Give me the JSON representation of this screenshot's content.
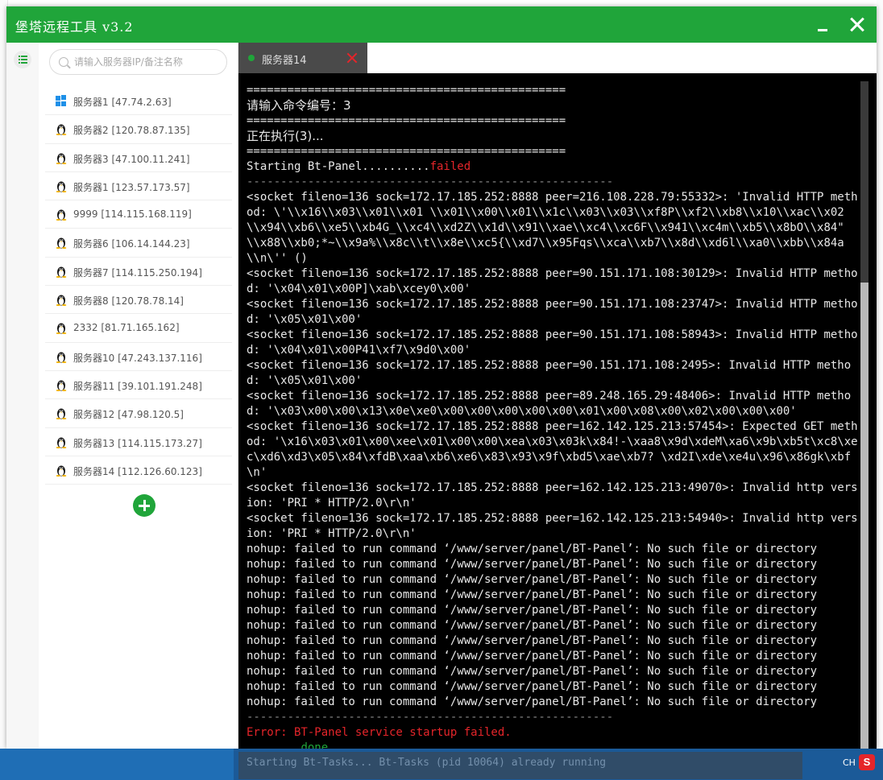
{
  "window": {
    "title": "堡塔远程工具 v3.2"
  },
  "sidebar": {
    "search_placeholder": "请输入服务器IP/备注名称",
    "servers": [
      {
        "label": "服务器1 [47.74.2.63]",
        "os": "windows-icon"
      },
      {
        "label": "服务器2 [120.78.87.135]",
        "os": "linux-icon"
      },
      {
        "label": "服务器3 [47.100.11.241]",
        "os": "linux-icon"
      },
      {
        "label": "服务器1 [123.57.173.57]",
        "os": "linux-icon"
      },
      {
        "label": "9999 [114.115.168.119]",
        "os": "linux-icon"
      },
      {
        "label": "服务器6 [106.14.144.23]",
        "os": "linux-icon"
      },
      {
        "label": "服务器7 [114.115.250.194]",
        "os": "linux-icon"
      },
      {
        "label": "服务器8 [120.78.78.14]",
        "os": "linux-icon"
      },
      {
        "label": "2332 [81.71.165.162]",
        "os": "linux-icon"
      },
      {
        "label": "服务器10 [47.243.137.116]",
        "os": "linux-icon"
      },
      {
        "label": "服务器11 [39.101.191.248]",
        "os": "linux-icon"
      },
      {
        "label": "服务器12 [47.98.120.5]",
        "os": "linux-icon"
      },
      {
        "label": "服务器13 [114.115.173.27]",
        "os": "linux-icon"
      },
      {
        "label": "服务器14 [112.126.60.123]",
        "os": "linux-icon"
      }
    ]
  },
  "tabs": [
    {
      "label": "服务器14",
      "status_color": "#20a53a"
    }
  ],
  "terminal": {
    "lines": [
      {
        "text": "===============================================",
        "cls": ""
      },
      {
        "text": "请输入命令编号：3",
        "cls": "big"
      },
      {
        "text": "===============================================",
        "cls": ""
      },
      {
        "text": "正在执行(3)...",
        "cls": "big"
      },
      {
        "text": "===============================================",
        "cls": ""
      },
      {
        "text": "Starting Bt-Panel..........",
        "suffix": "failed",
        "suffix_cls": "red",
        "cls": ""
      },
      {
        "text": "------------------------------------------------------",
        "cls": "dashed"
      },
      {
        "text": "<socket fileno=136 sock=172.17.185.252:8888 peer=216.108.228.79:55332>: 'Invalid HTTP method: \\'\\\\x16\\\\x03\\\\x01\\\\x01 \\\\x01\\\\x00\\\\x01\\\\x1c\\\\x03\\\\x03\\\\xf8P\\\\xf2\\\\xb8\\\\x10\\\\xac\\\\x02 \\\\x94\\\\xb6\\\\xe5\\\\xb4G_\\\\xc4\\\\xd2Z\\\\x1d\\\\x91\\\\xae\\\\xc4\\\\xc6F\\\\x941\\\\xc4m\\\\xb5\\\\x8bO\\\\x84\" \\\\x88\\\\xb0;*~\\\\x9a%\\\\x8c\\\\t\\\\x8e\\\\xc5{\\\\xd7\\\\x95Fqs\\\\xca\\\\xb7\\\\x8d\\\\xd6l\\\\xa0\\\\xbb\\\\x84a\\\\n\\'' ()",
        "cls": ""
      },
      {
        "text": "<socket fileno=136 sock=172.17.185.252:8888 peer=90.151.171.108:30129>: Invalid HTTP method: '\\x04\\x01\\x00P]\\xab\\xcey0\\x00'",
        "cls": ""
      },
      {
        "text": "<socket fileno=136 sock=172.17.185.252:8888 peer=90.151.171.108:23747>: Invalid HTTP method: '\\x05\\x01\\x00'",
        "cls": ""
      },
      {
        "text": "<socket fileno=136 sock=172.17.185.252:8888 peer=90.151.171.108:58943>: Invalid HTTP method: '\\x04\\x01\\x00P41\\xf7\\x9d0\\x00'",
        "cls": ""
      },
      {
        "text": "<socket fileno=136 sock=172.17.185.252:8888 peer=90.151.171.108:2495>: Invalid HTTP method: '\\x05\\x01\\x00'",
        "cls": ""
      },
      {
        "text": "<socket fileno=136 sock=172.17.185.252:8888 peer=89.248.165.29:48406>: Invalid HTTP method: '\\x03\\x00\\x00\\x13\\x0e\\xe0\\x00\\x00\\x00\\x00\\x00\\x01\\x00\\x08\\x00\\x02\\x00\\x00\\x00'",
        "cls": ""
      },
      {
        "text": "<socket fileno=136 sock=172.17.185.252:8888 peer=162.142.125.213:57454>: Expected GET method: '\\x16\\x03\\x01\\x00\\xee\\x01\\x00\\x00\\xea\\x03\\x03k\\x84!-\\xaa8\\x9d\\xdeM\\xa6\\x9b\\xb5t\\xc8\\xec\\xd6\\xd3\\x05\\x84\\xfdB\\xaa\\xb6\\xe6\\x83\\x93\\x9f\\xbd5\\xae\\xb7? \\xd2I\\xde\\xe4u\\x96\\x86gk\\xbf\\n'",
        "cls": ""
      },
      {
        "text": "<socket fileno=136 sock=172.17.185.252:8888 peer=162.142.125.213:49070>: Invalid http version: 'PRI * HTTP/2.0\\r\\n'",
        "cls": ""
      },
      {
        "text": "<socket fileno=136 sock=172.17.185.252:8888 peer=162.142.125.213:54940>: Invalid http version: 'PRI * HTTP/2.0\\r\\n'",
        "cls": ""
      },
      {
        "text": "nohup: failed to run command ‘/www/server/panel/BT-Panel’: No such file or directory",
        "cls": ""
      },
      {
        "text": "nohup: failed to run command ‘/www/server/panel/BT-Panel’: No such file or directory",
        "cls": ""
      },
      {
        "text": "nohup: failed to run command ‘/www/server/panel/BT-Panel’: No such file or directory",
        "cls": ""
      },
      {
        "text": "nohup: failed to run command ‘/www/server/panel/BT-Panel’: No such file or directory",
        "cls": ""
      },
      {
        "text": "nohup: failed to run command ‘/www/server/panel/BT-Panel’: No such file or directory",
        "cls": ""
      },
      {
        "text": "nohup: failed to run command ‘/www/server/panel/BT-Panel’: No such file or directory",
        "cls": ""
      },
      {
        "text": "nohup: failed to run command ‘/www/server/panel/BT-Panel’: No such file or directory",
        "cls": ""
      },
      {
        "text": "nohup: failed to run command ‘/www/server/panel/BT-Panel’: No such file or directory",
        "cls": ""
      },
      {
        "text": "nohup: failed to run command ‘/www/server/panel/BT-Panel’: No such file or directory",
        "cls": ""
      },
      {
        "text": "nohup: failed to run command ‘/www/server/panel/BT-Panel’: No such file or directory",
        "cls": ""
      },
      {
        "text": "nohup: failed to run command ‘/www/server/panel/BT-Panel’: No such file or directory",
        "cls": ""
      },
      {
        "text": "------------------------------------------------------",
        "cls": "dashed"
      },
      {
        "text": "Error: BT-Panel service startup failed.",
        "cls": "red"
      },
      {
        "text": "        done",
        "cls": "green"
      }
    ]
  },
  "taskbar": {
    "ghost_text": "Starting Bt-Tasks... Bt-Tasks (pid 10064) already running",
    "lang": "CH",
    "ime": "S"
  },
  "colors": {
    "brand": "#20a53a",
    "danger": "#e5252a",
    "terminal_bg": "#000000"
  }
}
